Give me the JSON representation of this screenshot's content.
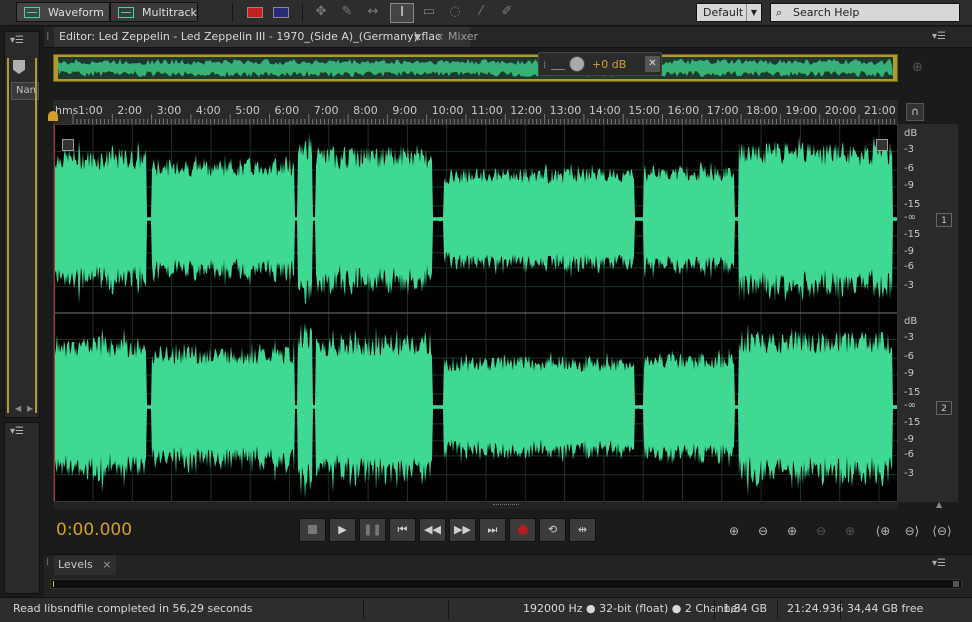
{
  "toolbar": {
    "waveform_label": "Waveform",
    "multitrack_label": "Multitrack",
    "workspace_value": "Default",
    "search_placeholder": "Search Help"
  },
  "left_panel": {
    "name_column": "Nan"
  },
  "editor": {
    "tab_title": "Editor: Led Zeppelin - Led Zeppelin III - 1970_(Side A)_(Germany).flac",
    "mixer_tab": "Mixer",
    "hud_gain": "+0 dB",
    "ruler_unit": "hms",
    "ruler_ticks": [
      "1:00",
      "2:00",
      "3:00",
      "4:00",
      "5:00",
      "6:00",
      "7:00",
      "8:00",
      "9:00",
      "10:00",
      "11:00",
      "12:00",
      "13:00",
      "14:00",
      "15:00",
      "16:00",
      "17:00",
      "18:00",
      "19:00",
      "20:00",
      "21:00"
    ],
    "db_header": "dB",
    "db_labels": [
      "-3",
      "-6",
      "-9",
      "-15",
      "-∞",
      "-15",
      "-9",
      "-6",
      "-3"
    ],
    "channels": [
      "1",
      "2"
    ],
    "timecode": "0:00.000"
  },
  "levels_panel": {
    "title": "Levels"
  },
  "status": {
    "message": "Read libsndfile completed in 56,29 seconds",
    "format": "192000 Hz ● 32-bit (float) ● 2 Channel",
    "size": "1,84 GB",
    "duration": "21:24.936",
    "free": "34,44 GB free"
  },
  "colors": {
    "waveform": "#3fd994",
    "timecode": "#d1a12a",
    "background": "#1b1b1b",
    "overview_frame": "#b39a2b"
  }
}
